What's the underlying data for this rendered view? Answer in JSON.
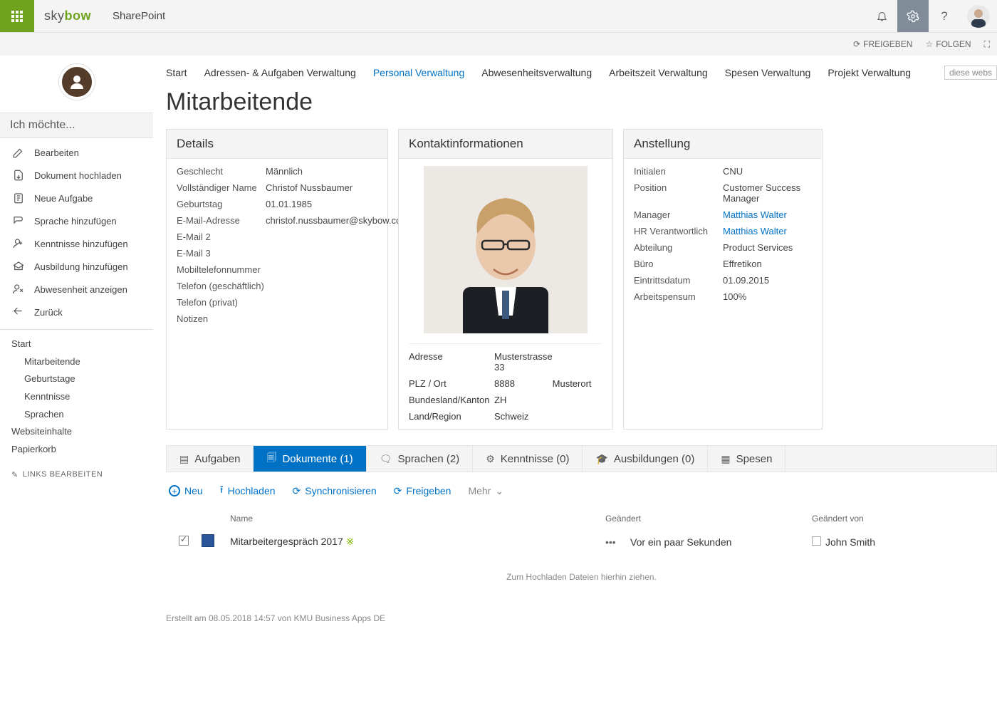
{
  "top": {
    "brand": "skybow",
    "app": "SharePoint",
    "share": "FREIGEBEN",
    "follow": "FOLGEN"
  },
  "sidebar": {
    "heading": "Ich möchte...",
    "actions": [
      {
        "label": "Bearbeiten"
      },
      {
        "label": "Dokument hochladen"
      },
      {
        "label": "Neue Aufgabe"
      },
      {
        "label": "Sprache hinzufügen"
      },
      {
        "label": "Kenntnisse hinzufügen"
      },
      {
        "label": "Ausbildung hinzufügen"
      },
      {
        "label": "Abwesenheit anzeigen"
      },
      {
        "label": "Zurück"
      }
    ],
    "nav": {
      "start": "Start",
      "items": [
        "Mitarbeitende",
        "Geburtstage",
        "Kenntnisse",
        "Sprachen"
      ],
      "site": "Websiteinhalte",
      "bin": "Papierkorb",
      "edit": "LINKS BEARBEITEN"
    }
  },
  "tabs": {
    "items": [
      "Start",
      "Adressen- & Aufgaben Verwaltung",
      "Personal Verwaltung",
      "Abwesenheitsverwaltung",
      "Arbeitszeit Verwaltung",
      "Spesen Verwaltung",
      "Projekt Verwaltung"
    ],
    "activeIndex": 2,
    "search": "diese webs"
  },
  "page_title": "Mitarbeitende",
  "details": {
    "header": "Details",
    "rows": [
      {
        "label": "Geschlecht",
        "value": "Männlich"
      },
      {
        "label": "Vollständiger Name",
        "value": "Christof Nussbaumer"
      },
      {
        "label": "Geburtstag",
        "value": "01.01.1985"
      },
      {
        "label": "E-Mail-Adresse",
        "value": "christof.nussbaumer@skybow.com"
      },
      {
        "label": "E-Mail 2",
        "value": ""
      },
      {
        "label": "E-Mail 3",
        "value": ""
      },
      {
        "label": "Mobiltelefonnummer",
        "value": ""
      },
      {
        "label": "Telefon (geschäftlich)",
        "value": ""
      },
      {
        "label": "Telefon (privat)",
        "value": ""
      },
      {
        "label": "Notizen",
        "value": ""
      }
    ]
  },
  "contact": {
    "header": "Kontaktinformationen",
    "address_rows": [
      {
        "label": "Adresse",
        "v1": "Musterstrasse 33",
        "v2": ""
      },
      {
        "label": "PLZ / Ort",
        "v1": "8888",
        "v2": "Musterort"
      },
      {
        "label": "Bundesland/Kanton",
        "v1": "ZH",
        "v2": ""
      },
      {
        "label": "Land/Region",
        "v1": "Schweiz",
        "v2": ""
      }
    ]
  },
  "employment": {
    "header": "Anstellung",
    "rows": [
      {
        "label": "Initialen",
        "value": "CNU",
        "link": false
      },
      {
        "label": "Position",
        "value": "Customer Success Manager",
        "link": false
      },
      {
        "label": "Manager",
        "value": "Matthias Walter",
        "link": true
      },
      {
        "label": "HR Verantwortlich",
        "value": "Matthias Walter",
        "link": true
      },
      {
        "label": "Abteilung",
        "value": "Product Services",
        "link": false
      },
      {
        "label": "Büro",
        "value": "Effretikon",
        "link": false
      },
      {
        "label": "Eintrittsdatum",
        "value": "01.09.2015",
        "link": false
      },
      {
        "label": "Arbeitspensum",
        "value": "100%",
        "link": false
      }
    ]
  },
  "tabstrip": [
    {
      "label": "Aufgaben",
      "count": ""
    },
    {
      "label": "Dokumente",
      "count": "(1)"
    },
    {
      "label": "Sprachen",
      "count": "(2)"
    },
    {
      "label": "Kenntnisse",
      "count": "(0)"
    },
    {
      "label": "Ausbildungen",
      "count": "(0)"
    },
    {
      "label": "Spesen",
      "count": ""
    }
  ],
  "tabstrip_active": 1,
  "toolbar": {
    "new": "Neu",
    "upload": "Hochladen",
    "sync": "Synchronisieren",
    "share": "Freigeben",
    "more": "Mehr"
  },
  "docs": {
    "cols": {
      "name": "Name",
      "modified": "Geändert",
      "by": "Geändert von"
    },
    "rows": [
      {
        "name": "Mitarbeitergespräch 2017",
        "modified": "Vor ein paar Sekunden",
        "by": "John Smith"
      }
    ],
    "hint": "Zum Hochladen Dateien hierhin ziehen."
  },
  "footer": "Erstellt am  08.05.2018 14:57 von  KMU Business Apps DE"
}
